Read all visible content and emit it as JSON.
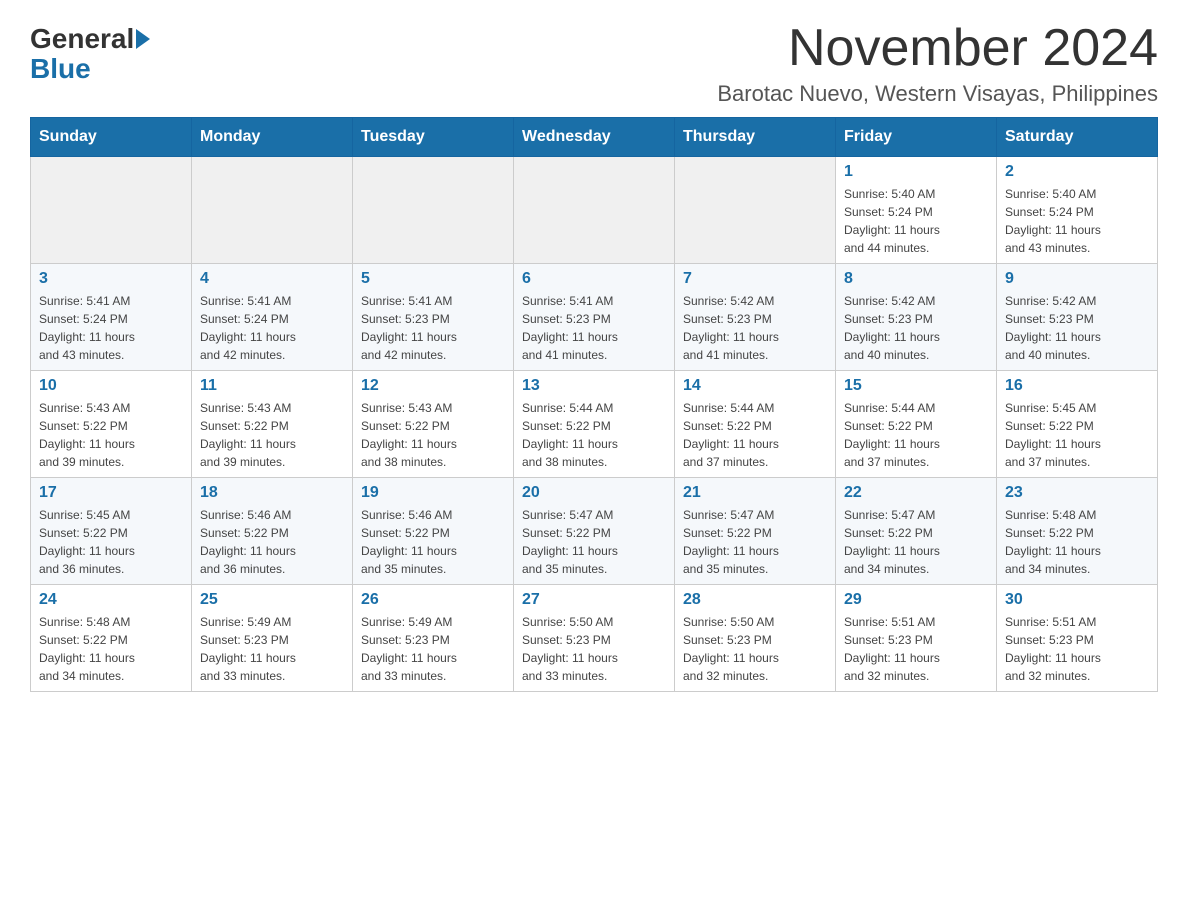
{
  "logo": {
    "general": "General",
    "blue": "Blue"
  },
  "title": "November 2024",
  "subtitle": "Barotac Nuevo, Western Visayas, Philippines",
  "days_header": [
    "Sunday",
    "Monday",
    "Tuesday",
    "Wednesday",
    "Thursday",
    "Friday",
    "Saturday"
  ],
  "weeks": [
    [
      {
        "num": "",
        "info": ""
      },
      {
        "num": "",
        "info": ""
      },
      {
        "num": "",
        "info": ""
      },
      {
        "num": "",
        "info": ""
      },
      {
        "num": "",
        "info": ""
      },
      {
        "num": "1",
        "info": "Sunrise: 5:40 AM\nSunset: 5:24 PM\nDaylight: 11 hours\nand 44 minutes."
      },
      {
        "num": "2",
        "info": "Sunrise: 5:40 AM\nSunset: 5:24 PM\nDaylight: 11 hours\nand 43 minutes."
      }
    ],
    [
      {
        "num": "3",
        "info": "Sunrise: 5:41 AM\nSunset: 5:24 PM\nDaylight: 11 hours\nand 43 minutes."
      },
      {
        "num": "4",
        "info": "Sunrise: 5:41 AM\nSunset: 5:24 PM\nDaylight: 11 hours\nand 42 minutes."
      },
      {
        "num": "5",
        "info": "Sunrise: 5:41 AM\nSunset: 5:23 PM\nDaylight: 11 hours\nand 42 minutes."
      },
      {
        "num": "6",
        "info": "Sunrise: 5:41 AM\nSunset: 5:23 PM\nDaylight: 11 hours\nand 41 minutes."
      },
      {
        "num": "7",
        "info": "Sunrise: 5:42 AM\nSunset: 5:23 PM\nDaylight: 11 hours\nand 41 minutes."
      },
      {
        "num": "8",
        "info": "Sunrise: 5:42 AM\nSunset: 5:23 PM\nDaylight: 11 hours\nand 40 minutes."
      },
      {
        "num": "9",
        "info": "Sunrise: 5:42 AM\nSunset: 5:23 PM\nDaylight: 11 hours\nand 40 minutes."
      }
    ],
    [
      {
        "num": "10",
        "info": "Sunrise: 5:43 AM\nSunset: 5:22 PM\nDaylight: 11 hours\nand 39 minutes."
      },
      {
        "num": "11",
        "info": "Sunrise: 5:43 AM\nSunset: 5:22 PM\nDaylight: 11 hours\nand 39 minutes."
      },
      {
        "num": "12",
        "info": "Sunrise: 5:43 AM\nSunset: 5:22 PM\nDaylight: 11 hours\nand 38 minutes."
      },
      {
        "num": "13",
        "info": "Sunrise: 5:44 AM\nSunset: 5:22 PM\nDaylight: 11 hours\nand 38 minutes."
      },
      {
        "num": "14",
        "info": "Sunrise: 5:44 AM\nSunset: 5:22 PM\nDaylight: 11 hours\nand 37 minutes."
      },
      {
        "num": "15",
        "info": "Sunrise: 5:44 AM\nSunset: 5:22 PM\nDaylight: 11 hours\nand 37 minutes."
      },
      {
        "num": "16",
        "info": "Sunrise: 5:45 AM\nSunset: 5:22 PM\nDaylight: 11 hours\nand 37 minutes."
      }
    ],
    [
      {
        "num": "17",
        "info": "Sunrise: 5:45 AM\nSunset: 5:22 PM\nDaylight: 11 hours\nand 36 minutes."
      },
      {
        "num": "18",
        "info": "Sunrise: 5:46 AM\nSunset: 5:22 PM\nDaylight: 11 hours\nand 36 minutes."
      },
      {
        "num": "19",
        "info": "Sunrise: 5:46 AM\nSunset: 5:22 PM\nDaylight: 11 hours\nand 35 minutes."
      },
      {
        "num": "20",
        "info": "Sunrise: 5:47 AM\nSunset: 5:22 PM\nDaylight: 11 hours\nand 35 minutes."
      },
      {
        "num": "21",
        "info": "Sunrise: 5:47 AM\nSunset: 5:22 PM\nDaylight: 11 hours\nand 35 minutes."
      },
      {
        "num": "22",
        "info": "Sunrise: 5:47 AM\nSunset: 5:22 PM\nDaylight: 11 hours\nand 34 minutes."
      },
      {
        "num": "23",
        "info": "Sunrise: 5:48 AM\nSunset: 5:22 PM\nDaylight: 11 hours\nand 34 minutes."
      }
    ],
    [
      {
        "num": "24",
        "info": "Sunrise: 5:48 AM\nSunset: 5:22 PM\nDaylight: 11 hours\nand 34 minutes."
      },
      {
        "num": "25",
        "info": "Sunrise: 5:49 AM\nSunset: 5:23 PM\nDaylight: 11 hours\nand 33 minutes."
      },
      {
        "num": "26",
        "info": "Sunrise: 5:49 AM\nSunset: 5:23 PM\nDaylight: 11 hours\nand 33 minutes."
      },
      {
        "num": "27",
        "info": "Sunrise: 5:50 AM\nSunset: 5:23 PM\nDaylight: 11 hours\nand 33 minutes."
      },
      {
        "num": "28",
        "info": "Sunrise: 5:50 AM\nSunset: 5:23 PM\nDaylight: 11 hours\nand 32 minutes."
      },
      {
        "num": "29",
        "info": "Sunrise: 5:51 AM\nSunset: 5:23 PM\nDaylight: 11 hours\nand 32 minutes."
      },
      {
        "num": "30",
        "info": "Sunrise: 5:51 AM\nSunset: 5:23 PM\nDaylight: 11 hours\nand 32 minutes."
      }
    ]
  ]
}
